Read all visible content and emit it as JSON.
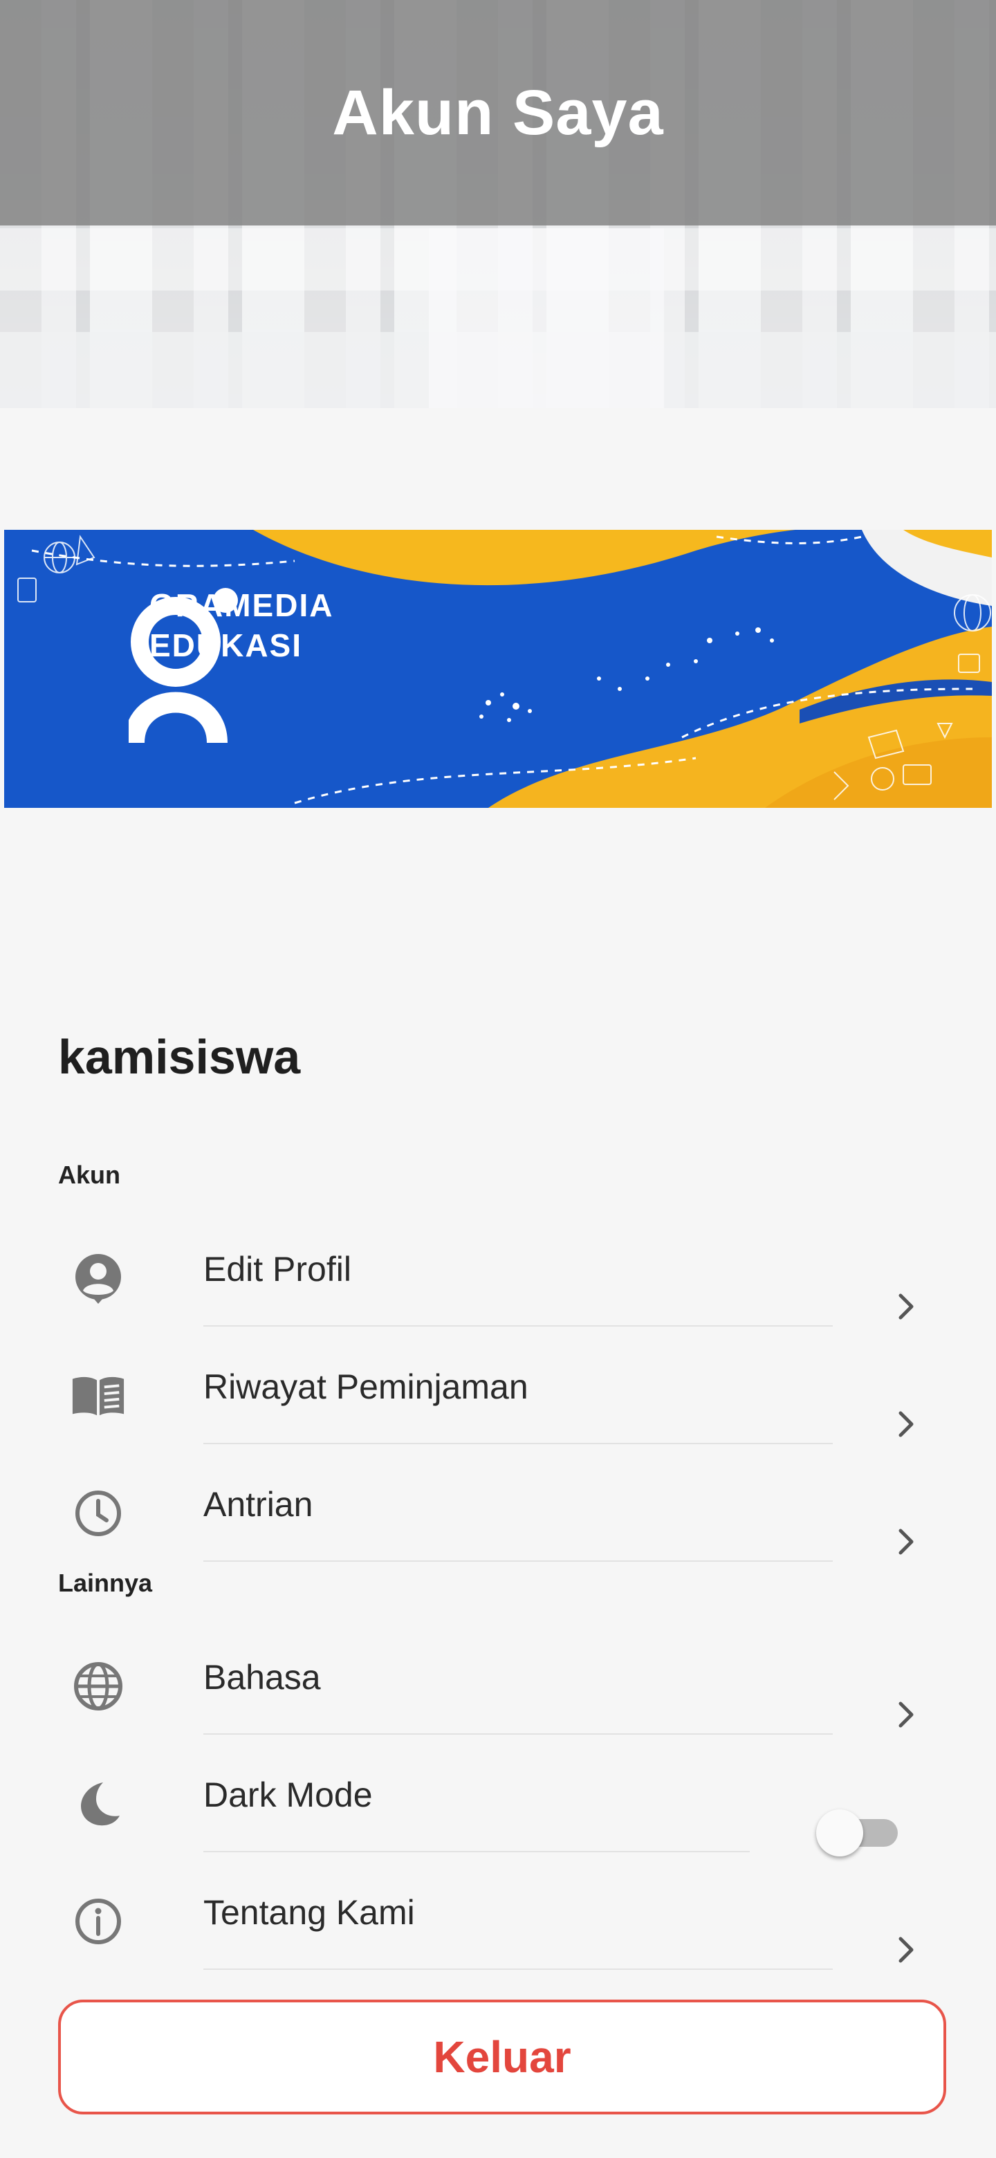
{
  "app_bar": {
    "title": "Akun Saya"
  },
  "banner": {
    "brand_line1": "GRAMEDIA",
    "brand_line2": "EDUKASI"
  },
  "user": {
    "username": "kamisiswa"
  },
  "sections": {
    "akun": {
      "label": "Akun",
      "items": [
        {
          "label": "Edit Profil",
          "icon": "account-circle-icon"
        },
        {
          "label": "Riwayat Peminjaman",
          "icon": "book-open-icon"
        },
        {
          "label": "Antrian",
          "icon": "clock-icon"
        }
      ]
    },
    "lainnya": {
      "label": "Lainnya",
      "items": [
        {
          "label": "Bahasa",
          "icon": "globe-icon"
        },
        {
          "label": "Dark Mode",
          "icon": "moon-icon",
          "toggle_on": false
        },
        {
          "label": "Tentang Kami",
          "icon": "info-icon"
        }
      ]
    }
  },
  "logout": {
    "label": "Keluar"
  },
  "colors": {
    "app_bar": "#808080",
    "banner_blue": "#1657c9",
    "banner_yellow": "#f5b41f",
    "logout_red": "#e3463d",
    "icon_gray": "#7a7a7a"
  }
}
